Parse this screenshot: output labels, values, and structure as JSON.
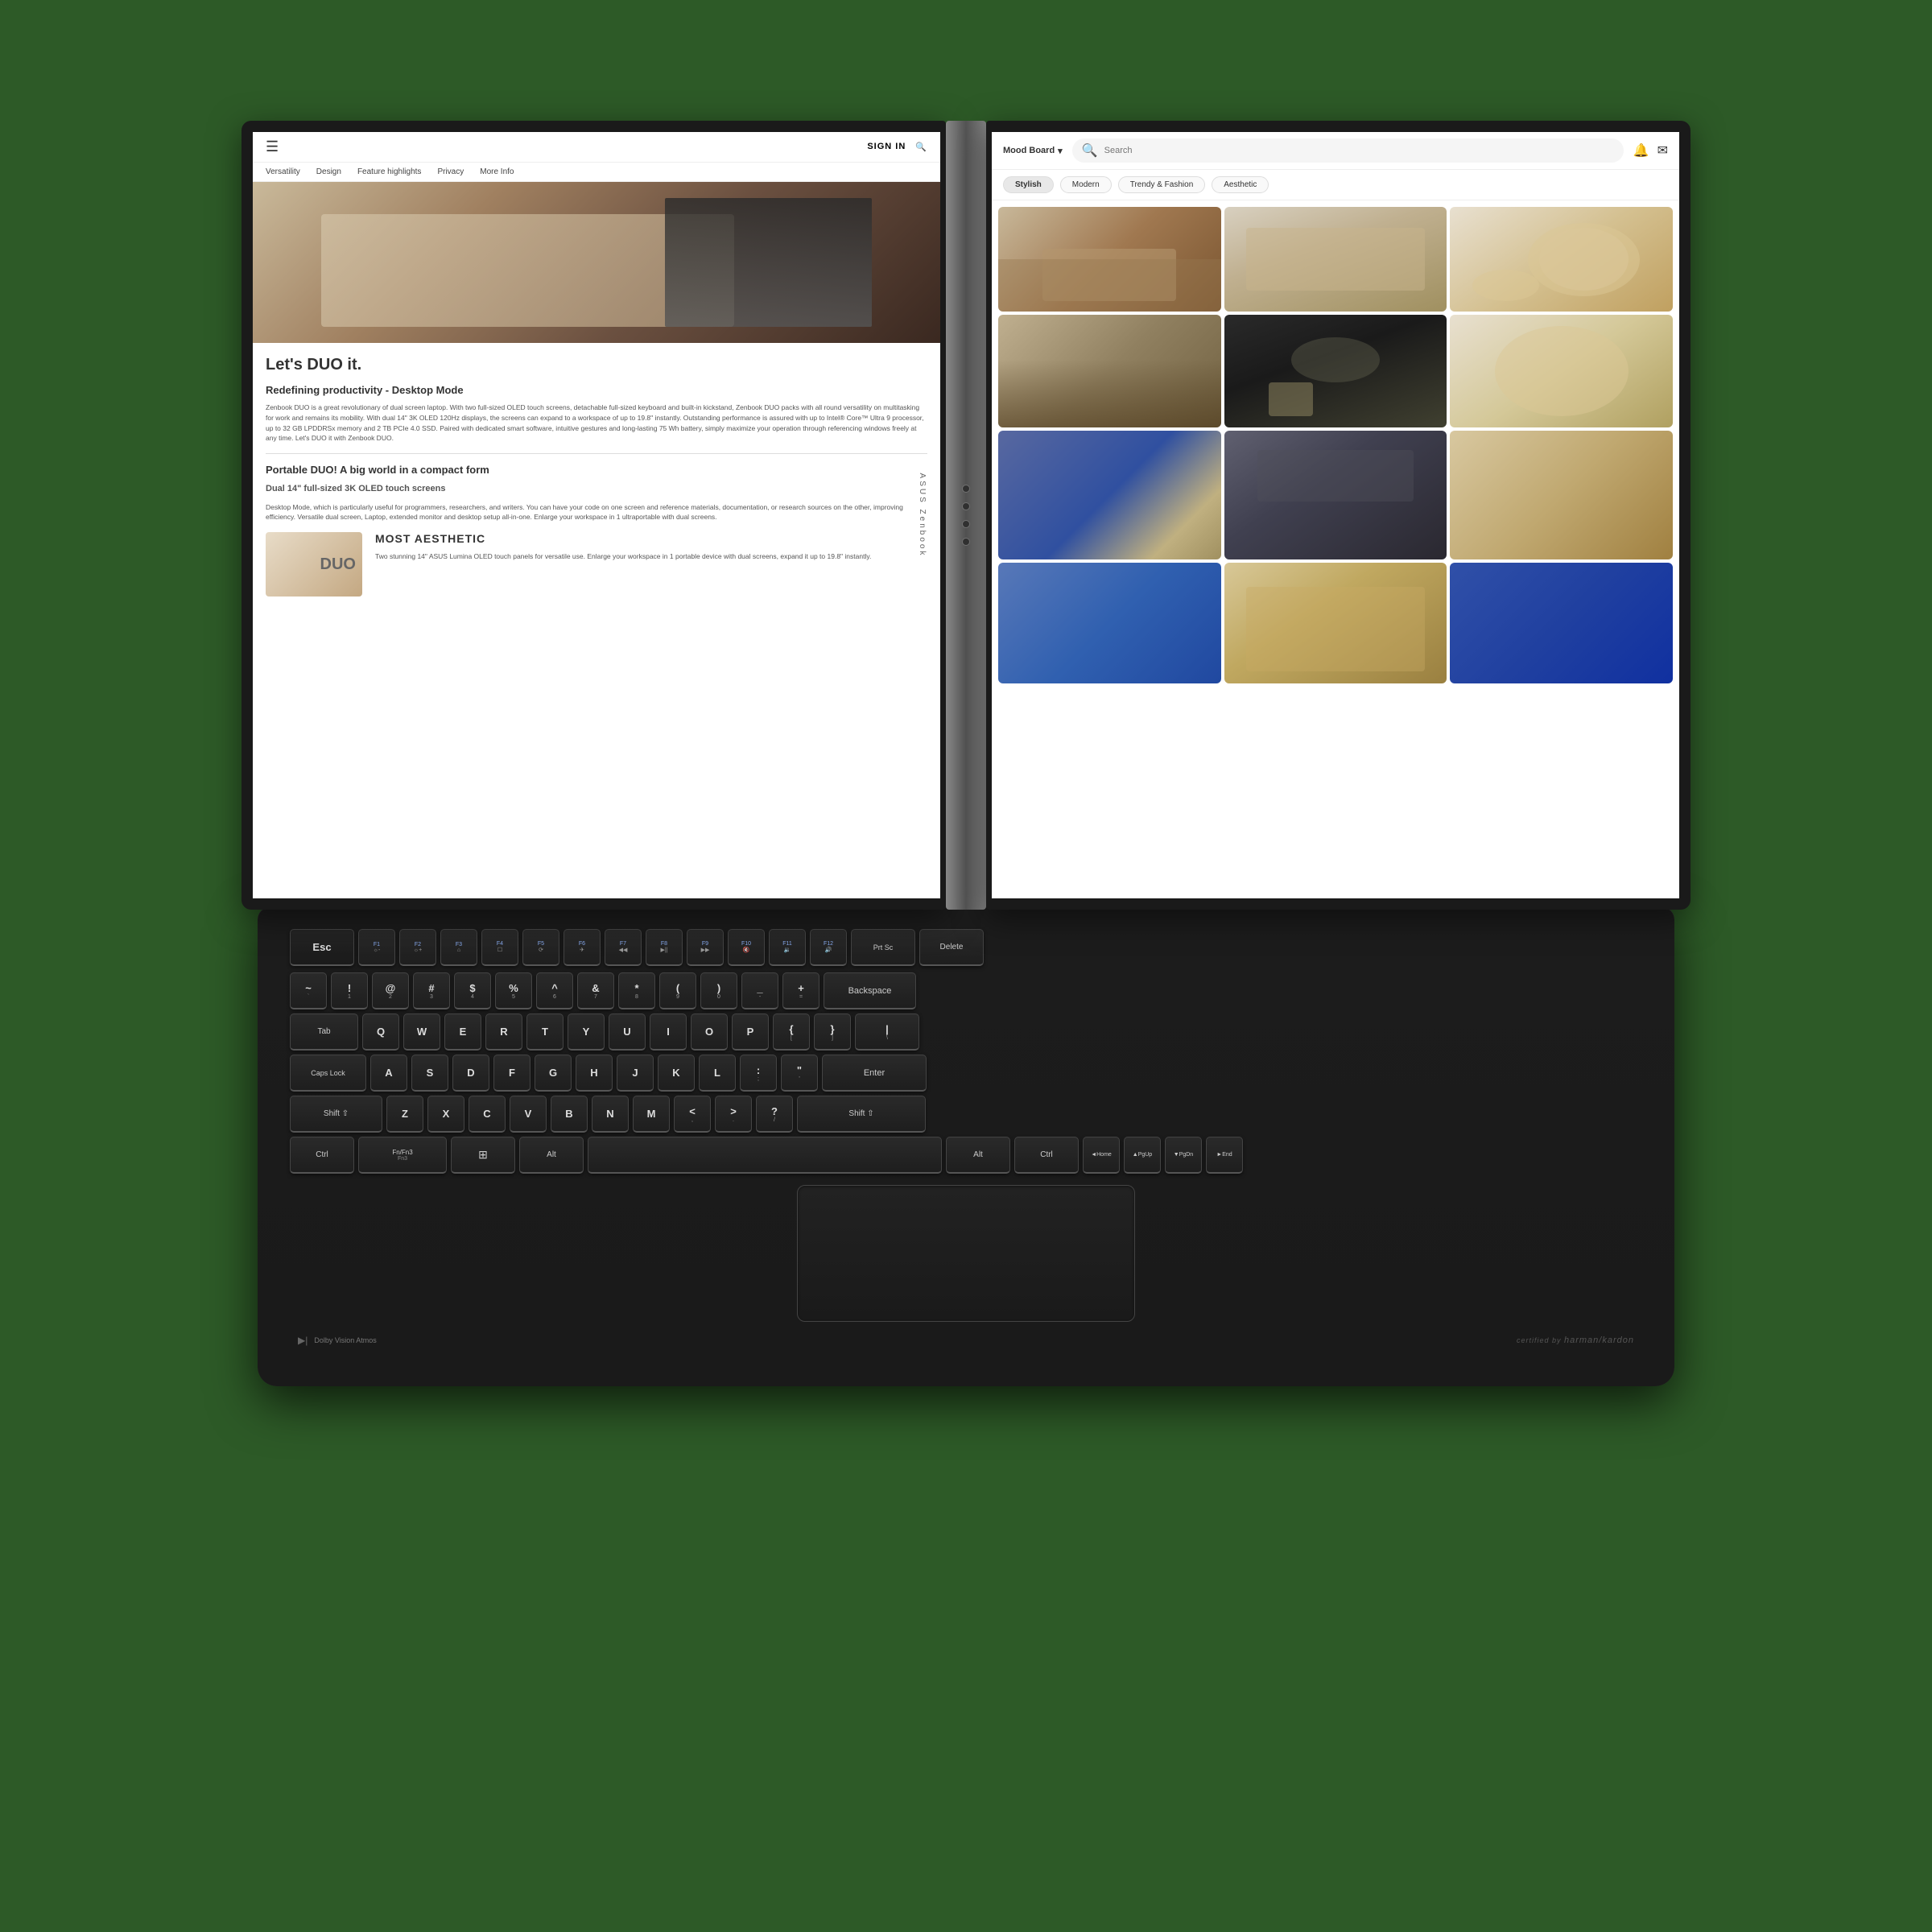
{
  "laptop": {
    "brand": "ASUS Zenbook",
    "model_line1": "Zenbook",
    "model_line2": "DUO",
    "sign_in": "SIGN IN",
    "left_screen": {
      "nav_items": [
        "Versatility",
        "Design",
        "Feature highlights",
        "Privacy",
        "More Info"
      ],
      "hero_tagline": "Let's DUO it.",
      "section1_title": "Redefining productivity - Desktop Mode",
      "section1_body": "Zenbook DUO is a great revolutionary of dual screen laptop. With two full-sized OLED touch screens, detachable full-sized keyboard and built-in kickstand, Zenbook DUO packs with all round versatility on multitasking for work and remains its mobility. With dual 14\" 3K OLED 120Hz displays, the screens can expand to a workspace of up to 19.8\" instantly. Outstanding performance is assured with up to Intel® Core™ Ultra 9 processor, up to 32 GB LPDDRSx memory and 2 TB PCIe 4.0 SSD. Paired with dedicated smart software, intuitive gestures and long-lasting 75 Wh battery, simply maximize your operation through referencing windows freely at any time. Let's DUO it with Zenbook DUO.",
      "section2_title": "Portable DUO! A big world in a compact form",
      "section2_subtitle": "Dual 14\" full-sized 3K OLED touch screens",
      "section2_body": "Desktop Mode, which is particularly useful for programmers, researchers, and writers. You can have your code on one screen and reference materials, documentation, or research sources on the other, improving efficiency.\n\nVersatile dual screen, Laptop, extended monitor and desktop setup all-in-one. Enlarge your workspace in 1 ultraportable with dual screens.",
      "duo_label": "DUO",
      "duo_feature_title": "MOST AESTHETIC",
      "duo_feature_body": "Two stunning 14\" ASUS Lumina OLED touch panels for versatile use. Enlarge your workspace in 1 portable device with dual screens, expand it up to 19.8\" instantly."
    },
    "right_screen": {
      "mood_board_label": "Mood Board",
      "search_placeholder": "Search",
      "tags": [
        "Stylish",
        "Modern",
        "Trendy & Fashion",
        "Aesthetic"
      ],
      "active_tag": ""
    },
    "keyboard": {
      "caps_lock_label": "Caps Lock",
      "dolby": "Dolby Vision Atmos",
      "sound": "harman/kardon",
      "rows": {
        "fn_row": [
          "Esc",
          "F1",
          "F2",
          "F3",
          "F4",
          "F5",
          "F6",
          "F7",
          "F8",
          "F9",
          "F10",
          "F11",
          "F12",
          "Prt Sc",
          "Delete"
        ],
        "num_row": [
          "`",
          "1",
          "2",
          "3",
          "4",
          "5",
          "6",
          "7",
          "8",
          "9",
          "0",
          "-",
          "=",
          "Backspace"
        ],
        "qwerty": [
          "Tab",
          "Q",
          "W",
          "E",
          "R",
          "T",
          "Y",
          "U",
          "I",
          "O",
          "P",
          "[",
          "]",
          "\\"
        ],
        "asdf": [
          "Caps Lock",
          "A",
          "S",
          "D",
          "F",
          "G",
          "H",
          "J",
          "K",
          "L",
          ";",
          "'",
          "Enter"
        ],
        "zxcv": [
          "Shift",
          "Z",
          "X",
          "C",
          "V",
          "B",
          "N",
          "M",
          ",",
          ".",
          "/",
          "Shift"
        ],
        "bottom": [
          "Ctrl",
          "Fn/Fn3",
          "Win",
          "Alt",
          "Space",
          "Alt",
          "Ctrl",
          "◄Home",
          "▲PgUp",
          "▼PgDn",
          "►End"
        ]
      }
    }
  }
}
